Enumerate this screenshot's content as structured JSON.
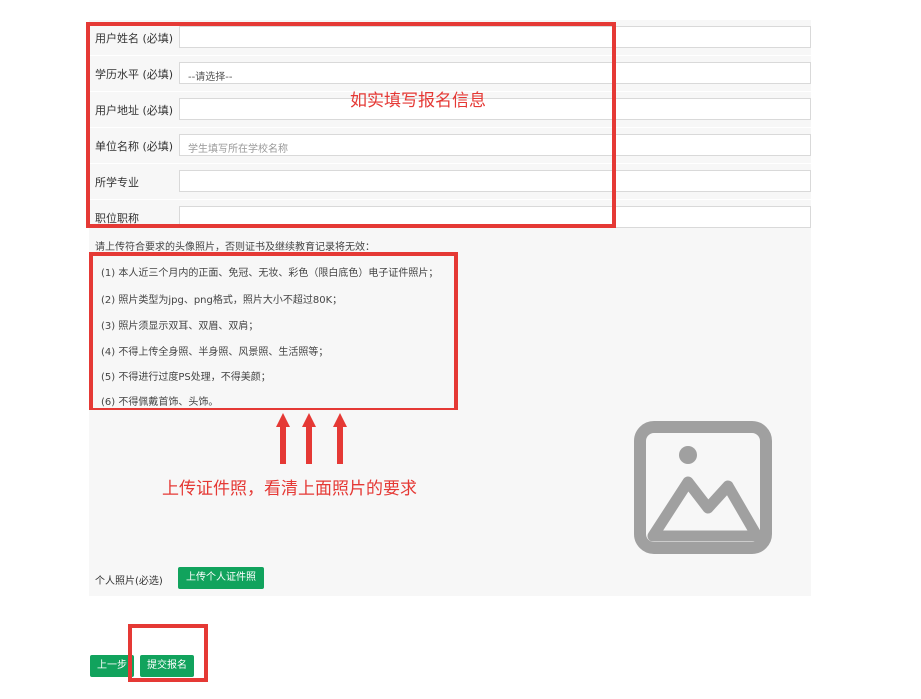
{
  "form": {
    "rows": [
      {
        "label": "用户姓名 (必填)",
        "value": "",
        "placeholder": ""
      },
      {
        "label": "学历水平 (必填)",
        "value": "--请选择--",
        "placeholder": ""
      },
      {
        "label": "用户地址 (必填)",
        "value": "",
        "placeholder": ""
      },
      {
        "label": "单位名称 (必填)",
        "value": "",
        "placeholder": "学生填写所在学校名称"
      },
      {
        "label": "所学专业",
        "value": "",
        "placeholder": ""
      },
      {
        "label": "职位职称",
        "value": "",
        "placeholder": ""
      }
    ]
  },
  "annotations": {
    "fill_info": "如实填写报名信息",
    "upload_hint": "上传证件照，看清上面照片的要求"
  },
  "requirements": {
    "intro": "请上传符合要求的头像照片，否则证书及继续教育记录将无效：",
    "items": [
      "(1) 本人近三个月内的正面、免冠、无妆、彩色（限白底色）电子证件照片；",
      "(2) 照片类型为jpg、png格式，照片大小不超过80K；",
      "(3) 照片须显示双耳、双眉、双肩；",
      "(4) 不得上传全身照、半身照、风景照、生活照等；",
      "(5) 不得进行过度PS处理，不得美颜；",
      "(6) 不得佩戴首饰、头饰。"
    ]
  },
  "upload": {
    "label": "个人照片(必选)",
    "button": "上传个人证件照",
    "placeholder_icon": "image-placeholder-icon"
  },
  "actions": {
    "prev": "上一步",
    "submit": "提交报名"
  },
  "colors": {
    "accent_green": "#11a35d",
    "annotation_red": "#e53935",
    "icon_gray": "#a0a0a0"
  }
}
